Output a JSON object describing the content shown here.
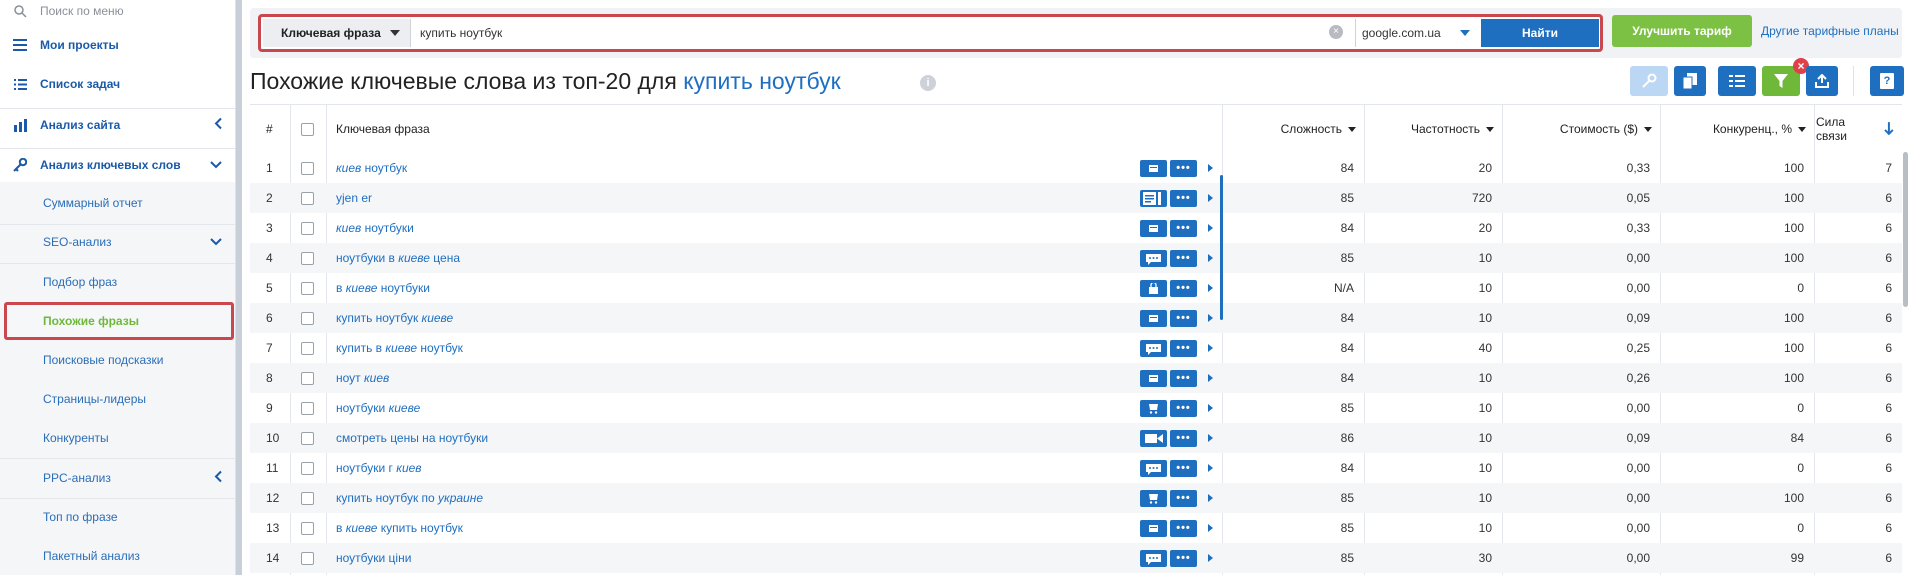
{
  "sidebar": {
    "search_placeholder": "Поиск по меню",
    "my_projects": "Мои проекты",
    "task_list": "Список задач",
    "site_analysis": "Анализ сайта",
    "keyword_analysis": "Анализ ключевых слов",
    "summary_report": "Суммарный отчет",
    "seo_analysis": "SEO-анализ",
    "phrase_selection": "Подбор фраз",
    "similar_phrases": "Похожие фразы",
    "search_hints": "Поисковые подсказки",
    "leader_pages": "Страницы-лидеры",
    "competitors": "Конкуренты",
    "ppc_analysis": "PPC-анализ",
    "top_by_phrase": "Топ по фразе",
    "batch_analysis": "Пакетный анализ"
  },
  "search": {
    "type_label": "Ключевая фраза",
    "query": "купить ноутбук",
    "engine": "google.com.ua",
    "find_label": "Найти",
    "clear_symbol": "×"
  },
  "header": {
    "upgrade_label": "Улучшить тариф",
    "plans_link": "Другие тарифные планы"
  },
  "title": {
    "prefix": "Похожие ключевые слова из топ-20 для ",
    "keyword": "купить ноутбук",
    "info_symbol": "i"
  },
  "toolbar": {
    "filter_badge": "×",
    "help_symbol": "?"
  },
  "table": {
    "headers": {
      "num": "#",
      "phrase": "Ключевая фраза",
      "difficulty": "Сложность",
      "frequency": "Частотность",
      "cost": "Стоимость ($)",
      "competition": "Конкуренц., %",
      "relevance": "Сила связи"
    },
    "rows": [
      {
        "num": "1",
        "pre": "",
        "em": "киев",
        "post": " ноутбук",
        "icon": "serp",
        "diff": "84",
        "freq": "20",
        "cost": "0,33",
        "comp": "100",
        "rel": "7"
      },
      {
        "num": "2",
        "pre": "yjen er",
        "em": "",
        "post": "",
        "icon": "serp-list",
        "diff": "85",
        "freq": "720",
        "cost": "0,05",
        "comp": "100",
        "rel": "6"
      },
      {
        "num": "3",
        "pre": "",
        "em": "киев",
        "post": " ноутбуки",
        "icon": "serp",
        "diff": "84",
        "freq": "20",
        "cost": "0,33",
        "comp": "100",
        "rel": "6"
      },
      {
        "num": "4",
        "pre": "ноутбуки в ",
        "em": "киеве",
        "post": " цена",
        "icon": "chat",
        "diff": "85",
        "freq": "10",
        "cost": "0,00",
        "comp": "100",
        "rel": "6"
      },
      {
        "num": "5",
        "pre": "в ",
        "em": "киеве",
        "post": " ноутбуки",
        "icon": "bag",
        "diff": "N/A",
        "freq": "10",
        "cost": "0,00",
        "comp": "0",
        "rel": "6"
      },
      {
        "num": "6",
        "pre": "купить ноутбук ",
        "em": "киеве",
        "post": "",
        "icon": "serp",
        "diff": "84",
        "freq": "10",
        "cost": "0,09",
        "comp": "100",
        "rel": "6"
      },
      {
        "num": "7",
        "pre": "купить в ",
        "em": "киеве",
        "post": " ноутбук",
        "icon": "chat",
        "diff": "84",
        "freq": "40",
        "cost": "0,25",
        "comp": "100",
        "rel": "6"
      },
      {
        "num": "8",
        "pre": "ноут ",
        "em": "киев",
        "post": "",
        "icon": "serp",
        "diff": "84",
        "freq": "10",
        "cost": "0,26",
        "comp": "100",
        "rel": "6"
      },
      {
        "num": "9",
        "pre": "ноутбуки ",
        "em": "киеве",
        "post": "",
        "icon": "cart",
        "diff": "85",
        "freq": "10",
        "cost": "0,00",
        "comp": "0",
        "rel": "6"
      },
      {
        "num": "10",
        "pre": "смотреть цены на ноутбуки",
        "em": "",
        "post": "",
        "icon": "video",
        "diff": "86",
        "freq": "10",
        "cost": "0,09",
        "comp": "84",
        "rel": "6"
      },
      {
        "num": "11",
        "pre": "ноутбуки г ",
        "em": "киев",
        "post": "",
        "icon": "chat",
        "diff": "84",
        "freq": "10",
        "cost": "0,00",
        "comp": "0",
        "rel": "6"
      },
      {
        "num": "12",
        "pre": "купить ноутбук по ",
        "em": "украине",
        "post": "",
        "icon": "cart",
        "diff": "85",
        "freq": "10",
        "cost": "0,00",
        "comp": "100",
        "rel": "6"
      },
      {
        "num": "13",
        "pre": "в ",
        "em": "киеве",
        "post": " купить ноутбук",
        "icon": "serp",
        "diff": "85",
        "freq": "10",
        "cost": "0,00",
        "comp": "0",
        "rel": "6"
      },
      {
        "num": "14",
        "pre": "ноутбуки ціни",
        "em": "",
        "post": "",
        "icon": "chat",
        "diff": "85",
        "freq": "30",
        "cost": "0,00",
        "comp": "99",
        "rel": "6"
      }
    ],
    "more_symbol": "•••"
  },
  "colors": {
    "accent": "#1f6fc0",
    "upgrade": "#7cc143",
    "highlight_frame": "#c9474d",
    "active_item": "#6fb83a"
  }
}
